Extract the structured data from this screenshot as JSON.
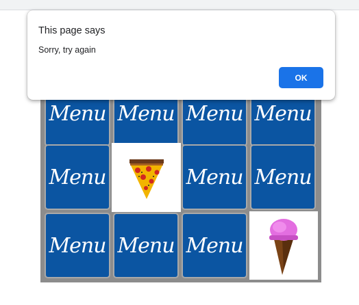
{
  "dialog": {
    "title": "This page says",
    "message": "Sorry, try again",
    "ok_label": "OK"
  },
  "board": {
    "card_back_text": "Menu",
    "cards": [
      {
        "state": "hidden"
      },
      {
        "state": "hidden"
      },
      {
        "state": "hidden"
      },
      {
        "state": "hidden"
      },
      {
        "state": "hidden"
      },
      {
        "state": "revealed",
        "icon": "pizza-slice-icon"
      },
      {
        "state": "hidden"
      },
      {
        "state": "hidden"
      },
      {
        "state": "hidden"
      },
      {
        "state": "hidden"
      },
      {
        "state": "hidden"
      },
      {
        "state": "revealed",
        "icon": "ice-cream-cone-icon"
      }
    ]
  }
}
